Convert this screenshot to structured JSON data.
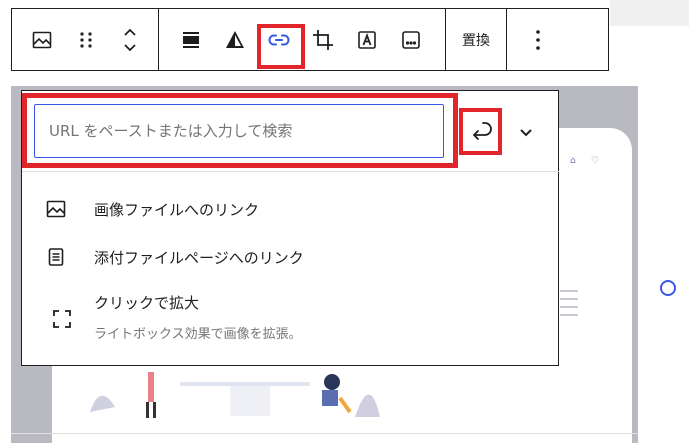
{
  "toolbar": {
    "replace_label": "置換"
  },
  "link_popover": {
    "url_placeholder": "URL をペーストまたは入力して検索",
    "menu": [
      {
        "label": "画像ファイルへのリンク"
      },
      {
        "label": "添付ファイルページへのリンク"
      }
    ],
    "lightbox": {
      "title": "クリックで拡大",
      "description": "ライトボックス効果で画像を拡張。"
    }
  },
  "colors": {
    "highlight": "#e2252b",
    "accent": "#3858e9",
    "text": "#1e1e1e",
    "muted": "#757575"
  }
}
